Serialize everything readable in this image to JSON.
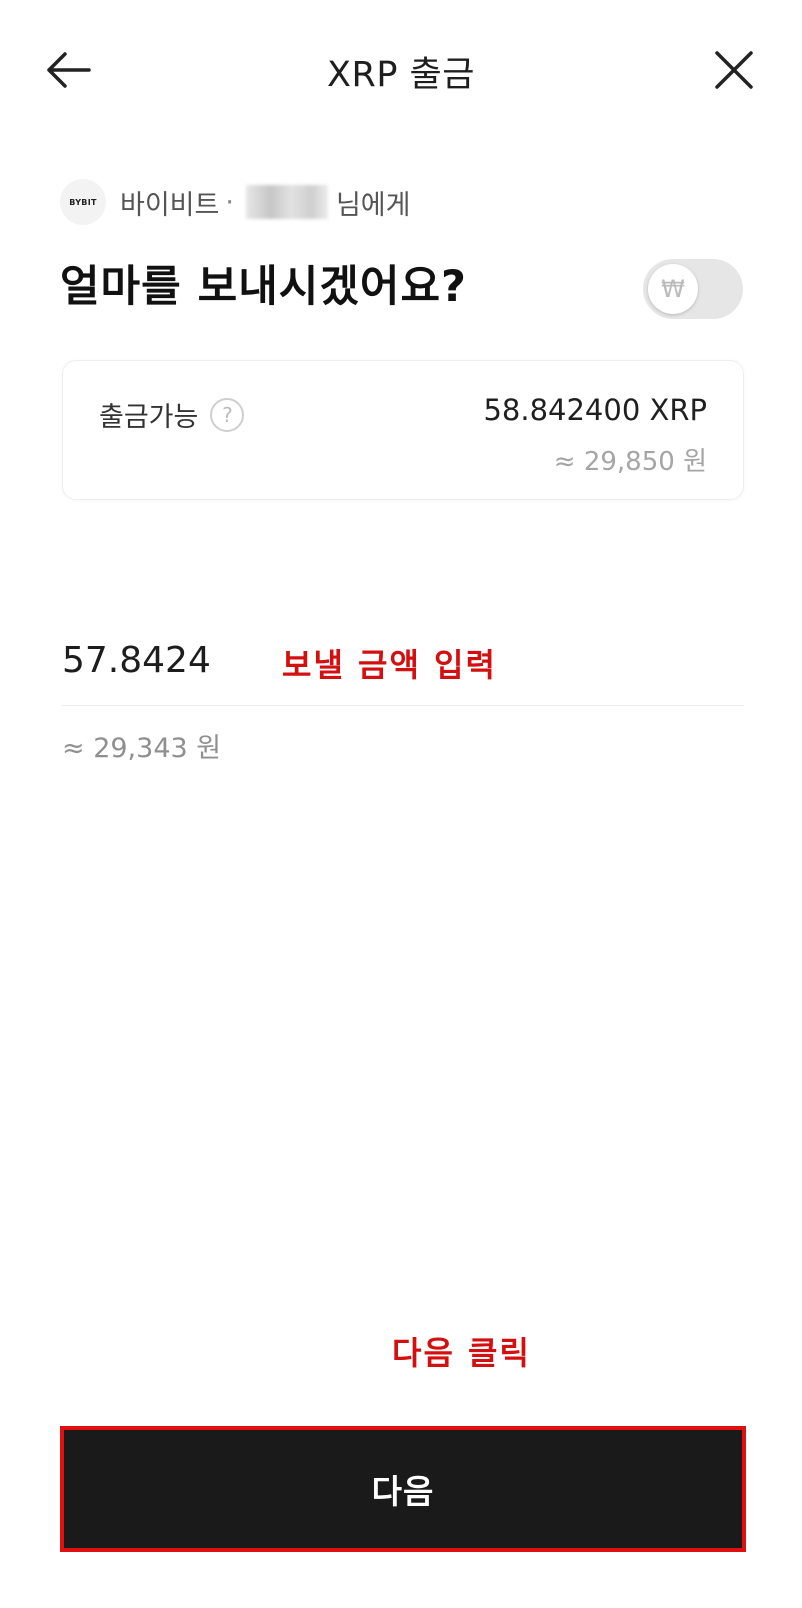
{
  "header": {
    "title": "XRP 출금",
    "back_icon": "arrow-left-icon",
    "close_icon": "close-icon"
  },
  "recipient": {
    "exchange": "바이비트",
    "separator": "·",
    "suffix": "님에게",
    "logo_text": "BYBIT"
  },
  "question": "얼마를 보내시겠어요?",
  "currency_toggle": {
    "symbol": "₩",
    "state": "off"
  },
  "balance": {
    "label": "출금가능",
    "help_symbol": "?",
    "amount": "58.842400 XRP",
    "krw": "≈ 29,850 원"
  },
  "amount_input": {
    "value": "57.8424",
    "krw": "≈ 29,343 원"
  },
  "annotations": {
    "amount": "보낼 금액 입력",
    "next": "다음 클릭",
    "color": "#d40f0f"
  },
  "next_button": {
    "label": "다음"
  }
}
